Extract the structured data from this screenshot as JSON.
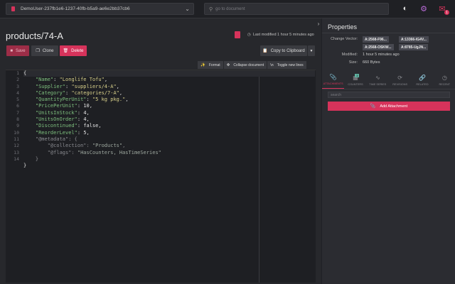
{
  "topbar": {
    "database": "DemoUser-237fb1e6-1237-40fb-b5a9-ae6e2bb37cb6",
    "search_placeholder": "go to document",
    "notification_count": "1"
  },
  "document": {
    "title": "products/74-A",
    "last_modified": "Last modified 1 hour 5 minutes ago"
  },
  "toolbar": {
    "save": "Save",
    "clone": "Clone",
    "delete": "Delete",
    "copy": "Copy to Clipboard",
    "format": "Format",
    "collapse": "Collapse document",
    "toggle_newlines_icon": "\\n",
    "toggle_newlines": "Toggle new lines"
  },
  "editor": {
    "line_numbers": [
      "1",
      "2",
      "3",
      "4",
      "5",
      "6",
      "7",
      "8",
      "9",
      "10",
      "11",
      "12",
      "13",
      "14"
    ],
    "lines": [
      [
        {
          "t": "{",
          "c": "n"
        }
      ],
      [
        {
          "t": "    ",
          "c": "n"
        },
        {
          "t": "\"Name\"",
          "c": "k"
        },
        {
          "t": ": ",
          "c": "n"
        },
        {
          "t": "\"Longlife Tofu\"",
          "c": "s"
        },
        {
          "t": ",",
          "c": "n"
        }
      ],
      [
        {
          "t": "    ",
          "c": "n"
        },
        {
          "t": "\"Supplier\"",
          "c": "k"
        },
        {
          "t": ": ",
          "c": "n"
        },
        {
          "t": "\"suppliers/4-A\"",
          "c": "s"
        },
        {
          "t": ",",
          "c": "n"
        }
      ],
      [
        {
          "t": "    ",
          "c": "n"
        },
        {
          "t": "\"Category\"",
          "c": "k"
        },
        {
          "t": ": ",
          "c": "n"
        },
        {
          "t": "\"categories/7-A\"",
          "c": "s"
        },
        {
          "t": ",",
          "c": "n"
        }
      ],
      [
        {
          "t": "    ",
          "c": "n"
        },
        {
          "t": "\"QuantityPerUnit\"",
          "c": "k"
        },
        {
          "t": ": ",
          "c": "n"
        },
        {
          "t": "\"5 kg pkg.\"",
          "c": "s"
        },
        {
          "t": ",",
          "c": "n"
        }
      ],
      [
        {
          "t": "    ",
          "c": "n"
        },
        {
          "t": "\"PricePerUnit\"",
          "c": "k"
        },
        {
          "t": ": ",
          "c": "n"
        },
        {
          "t": "10",
          "c": "n"
        },
        {
          "t": ",",
          "c": "n"
        }
      ],
      [
        {
          "t": "    ",
          "c": "n"
        },
        {
          "t": "\"UnitsInStock\"",
          "c": "k"
        },
        {
          "t": ": ",
          "c": "n"
        },
        {
          "t": "4",
          "c": "n"
        },
        {
          "t": ",",
          "c": "n"
        }
      ],
      [
        {
          "t": "    ",
          "c": "n"
        },
        {
          "t": "\"UnitsOnOrder\"",
          "c": "k"
        },
        {
          "t": ": ",
          "c": "n"
        },
        {
          "t": "4",
          "c": "n"
        },
        {
          "t": ",",
          "c": "n"
        }
      ],
      [
        {
          "t": "    ",
          "c": "n"
        },
        {
          "t": "\"Discontinued\"",
          "c": "k"
        },
        {
          "t": ": ",
          "c": "n"
        },
        {
          "t": "false",
          "c": "n"
        },
        {
          "t": ",",
          "c": "n"
        }
      ],
      [
        {
          "t": "    ",
          "c": "n"
        },
        {
          "t": "\"ReorderLevel\"",
          "c": "k"
        },
        {
          "t": ": ",
          "c": "n"
        },
        {
          "t": "5",
          "c": "n"
        },
        {
          "t": ",",
          "c": "n"
        }
      ],
      [
        {
          "t": "    ",
          "c": "n"
        },
        {
          "t": "\"@metadata\"",
          "c": "meta"
        },
        {
          "t": ": {",
          "c": "meta"
        }
      ],
      [
        {
          "t": "        ",
          "c": "n"
        },
        {
          "t": "\"@collection\"",
          "c": "meta"
        },
        {
          "t": ": ",
          "c": "meta"
        },
        {
          "t": "\"Products\"",
          "c": "metaval"
        },
        {
          "t": ",",
          "c": "meta"
        }
      ],
      [
        {
          "t": "        ",
          "c": "n"
        },
        {
          "t": "\"@flags\"",
          "c": "meta"
        },
        {
          "t": ": ",
          "c": "meta"
        },
        {
          "t": "\"HasCounters, HasTimeSeries\"",
          "c": "metaval"
        }
      ],
      [
        {
          "t": "    }",
          "c": "meta"
        }
      ],
      [
        {
          "t": "}",
          "c": "n"
        }
      ]
    ]
  },
  "properties": {
    "title": "Properties",
    "change_vector_label": "Change Vector:",
    "change_vector": [
      "A:2568-F96...",
      "A:13366-IG4V...",
      "A:2568-OSKW...",
      "A:8785-UgJN..."
    ],
    "modified_label": "Modified:",
    "modified_value": "1 hour 5 minutes ago",
    "size_label": "Size:",
    "size_value": "660 Bytes"
  },
  "tabs": [
    {
      "label": "ATTACHMENTS",
      "icon": "paperclip-icon"
    },
    {
      "label": "COUNTERS",
      "icon": "counter-icon",
      "badge": "3"
    },
    {
      "label": "TIME SERIES",
      "icon": "timeseries-icon"
    },
    {
      "label": "REVISIONS",
      "icon": "revisions-icon"
    },
    {
      "label": "RELATED",
      "icon": "link-icon"
    },
    {
      "label": "RECENT",
      "icon": "clock-icon"
    }
  ],
  "attachments": {
    "search_placeholder": "search",
    "add_label": "Add Attachment"
  },
  "colors": {
    "accent": "#d6335b",
    "background": "#27282c",
    "panel": "#2b2c31"
  }
}
